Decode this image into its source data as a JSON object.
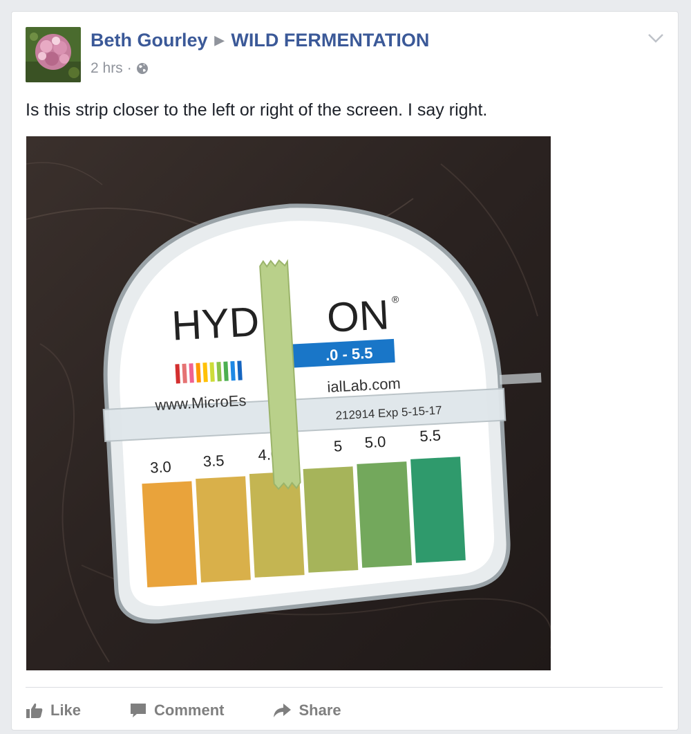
{
  "post": {
    "author": "Beth Gourley",
    "group": "WILD FERMENTATION",
    "time": "2 hrs",
    "separator": "·",
    "text": "Is this strip closer to the left or right of the screen. I say right."
  },
  "photo": {
    "brand_left": "HYD",
    "brand_right": "ON",
    "registered": "®",
    "range_label": ".0 - 5.5",
    "url_left": "www.MicroEs",
    "url_right": "ialLab.com",
    "lot": "212914  Exp 5-15-17",
    "scale_labels": [
      "3.0",
      "3.5",
      "4.0",
      "5",
      "5.0",
      "5.5"
    ]
  },
  "actions": {
    "like": "Like",
    "comment": "Comment",
    "share": "Share"
  }
}
